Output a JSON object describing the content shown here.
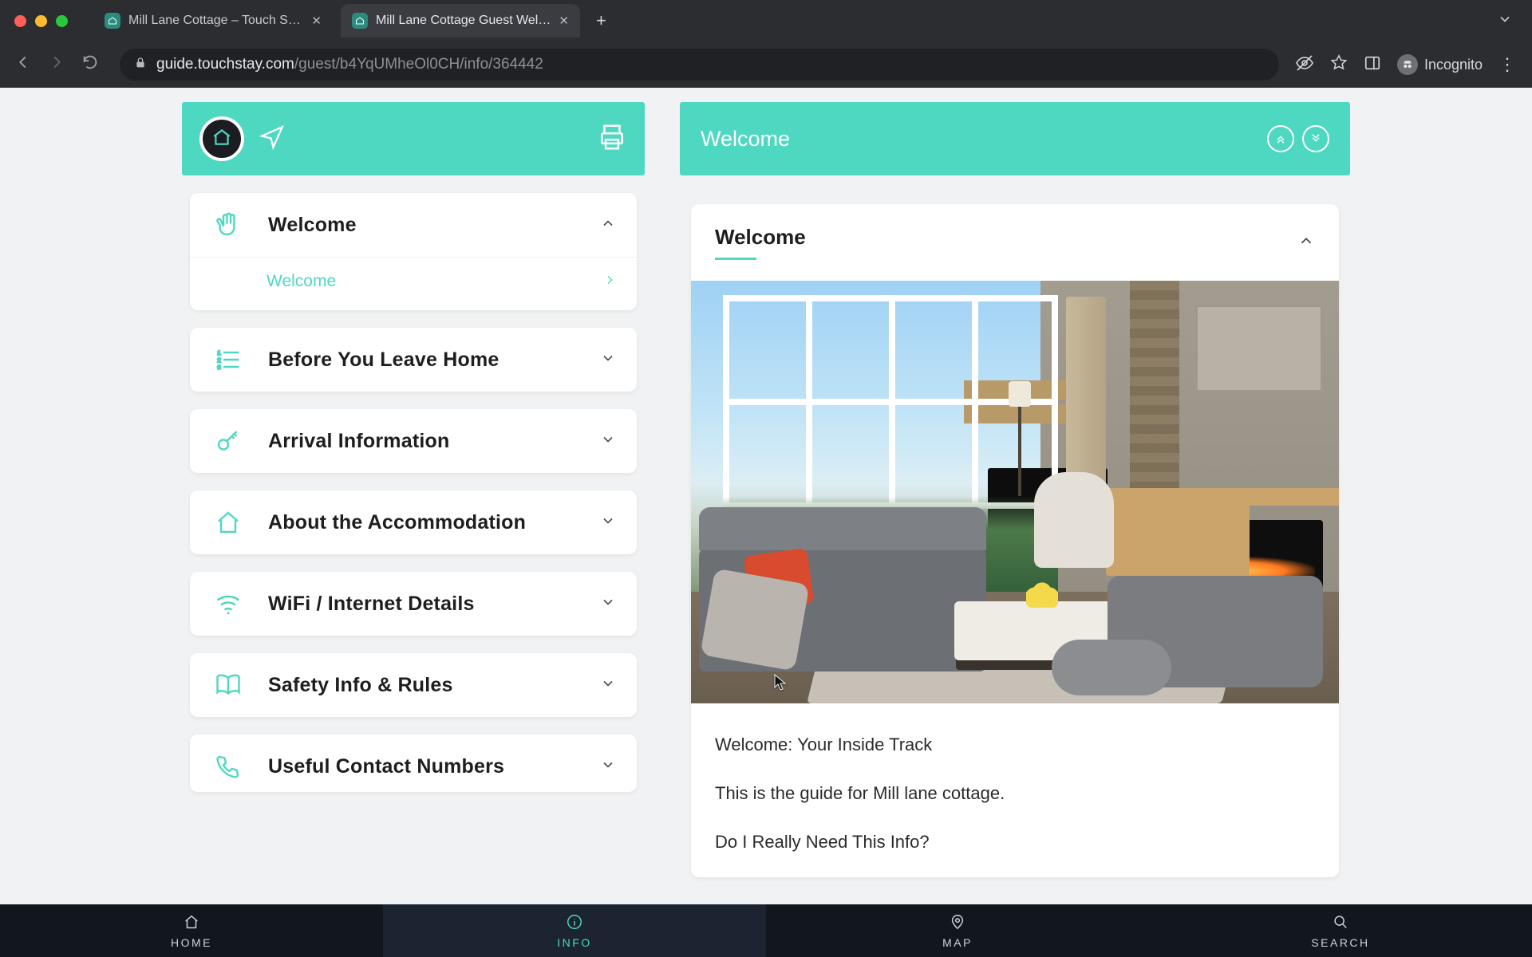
{
  "browser": {
    "tabs": [
      {
        "title": "Mill Lane Cottage – Touch Stay",
        "active": false
      },
      {
        "title": "Mill Lane Cottage Guest Welco",
        "active": true
      }
    ],
    "url_domain": "guide.touchstay.com",
    "url_path": "/guest/b4YqUMheOl0CH/info/364442",
    "incognito_label": "Incognito"
  },
  "theme": {
    "accent": "#4fd8c1"
  },
  "left_header_title": "",
  "sidebar": {
    "items": [
      {
        "id": "welcome",
        "label": "Welcome",
        "icon": "hand",
        "expanded": true,
        "children": [
          {
            "id": "welcome-sub",
            "label": "Welcome"
          }
        ]
      },
      {
        "id": "before",
        "label": "Before You Leave Home",
        "icon": "checklist",
        "expanded": false
      },
      {
        "id": "arrival",
        "label": "Arrival Information",
        "icon": "key",
        "expanded": false
      },
      {
        "id": "about",
        "label": "About the Accommodation",
        "icon": "house",
        "expanded": false
      },
      {
        "id": "wifi",
        "label": "WiFi / Internet Details",
        "icon": "wifi",
        "expanded": false
      },
      {
        "id": "safety",
        "label": "Safety Info & Rules",
        "icon": "book",
        "expanded": false
      },
      {
        "id": "contacts",
        "label": "Useful Contact Numbers",
        "icon": "phone",
        "expanded": false
      }
    ]
  },
  "content": {
    "header_title": "Welcome",
    "section_title": "Welcome",
    "paragraphs": [
      "Welcome: Your Inside Track",
      "This is the guide for Mill lane cottage.",
      "Do I Really Need This Info?"
    ]
  },
  "bottom_nav": {
    "items": [
      {
        "id": "home",
        "label": "HOME",
        "icon": "house"
      },
      {
        "id": "info",
        "label": "INFO",
        "icon": "info",
        "active": true
      },
      {
        "id": "map",
        "label": "MAP",
        "icon": "pin"
      },
      {
        "id": "search",
        "label": "SEARCH",
        "icon": "search"
      }
    ]
  }
}
